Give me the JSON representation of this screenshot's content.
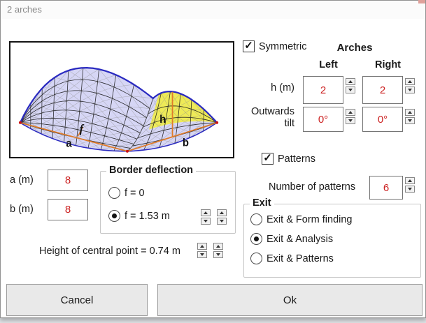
{
  "window": {
    "title": "2 arches"
  },
  "diagram": {
    "labels": {
      "a": "a",
      "b": "b",
      "h": "h",
      "f": "f"
    },
    "colors": {
      "membrane": "#d6d6f5",
      "highlight": "#efeb4e",
      "edge": "#2a2ac0",
      "base": "#e07b28",
      "marker": "#cc1111"
    }
  },
  "dimensions": {
    "a_label": "a (m)",
    "a_value": "8",
    "b_label": "b (m)",
    "b_value": "8"
  },
  "border_deflection": {
    "title": "Border deflection",
    "option_zero": {
      "label": "f = 0",
      "selected": false
    },
    "option_value": {
      "label": "f = 1.53 m",
      "selected": true
    }
  },
  "central_point": {
    "text": "Height of central point = 0.74 m"
  },
  "arches": {
    "symmetric": {
      "label": "Symmetric",
      "checked": true
    },
    "title": "Arches",
    "col_left": "Left",
    "col_right": "Right",
    "h_row": {
      "label": "h (m)",
      "left_value": "2",
      "right_value": "2"
    },
    "tilt_row": {
      "label_line1": "Outwards",
      "label_line2": "tilt",
      "left_value": "0°",
      "right_value": "0°"
    }
  },
  "patterns": {
    "checkbox": {
      "label": "Patterns",
      "checked": true
    },
    "count_label": "Number of patterns",
    "count_value": "6"
  },
  "exit": {
    "title": "Exit",
    "options": [
      {
        "label": "Exit & Form finding",
        "selected": false
      },
      {
        "label": "Exit & Analysis",
        "selected": true
      },
      {
        "label": "Exit & Patterns",
        "selected": false
      }
    ]
  },
  "footer": {
    "cancel_label": "Cancel",
    "ok_label": "Ok"
  },
  "value_color": "#cc2222"
}
